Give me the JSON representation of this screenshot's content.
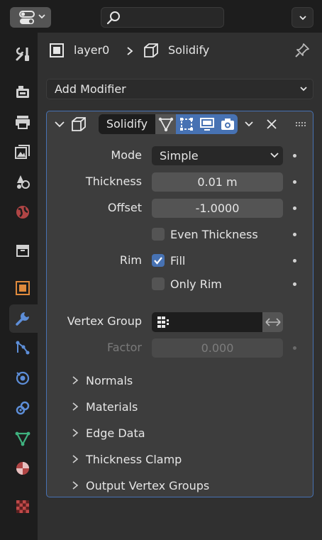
{
  "topbar": {
    "editor_type_icon": "properties-editor-icon",
    "search_icon": "search-icon",
    "search_placeholder": ""
  },
  "sidebar": {
    "tabs": [
      {
        "name": "tool",
        "icon": "wrench-screwdriver-icon",
        "active": false
      },
      {
        "name": "render",
        "icon": "camera-back-icon",
        "active": false
      },
      {
        "name": "output",
        "icon": "printer-icon",
        "active": false
      },
      {
        "name": "view-layer",
        "icon": "images-icon",
        "active": false
      },
      {
        "name": "scene",
        "icon": "scene-icon",
        "active": false
      },
      {
        "name": "world",
        "icon": "globe-icon",
        "active": false
      },
      {
        "name": "collection",
        "icon": "collection-box-icon",
        "active": false
      },
      {
        "name": "object",
        "icon": "object-square-icon",
        "active": false
      },
      {
        "name": "modifiers",
        "icon": "wrench-icon",
        "active": true
      },
      {
        "name": "particles",
        "icon": "particles-icon",
        "active": false
      },
      {
        "name": "physics",
        "icon": "physics-icon",
        "active": false
      },
      {
        "name": "constraints",
        "icon": "constraints-icon",
        "active": false
      },
      {
        "name": "data",
        "icon": "mesh-data-icon",
        "active": false
      },
      {
        "name": "material",
        "icon": "material-sphere-icon",
        "active": false
      },
      {
        "name": "texture",
        "icon": "checkerboard-icon",
        "active": false
      }
    ]
  },
  "header": {
    "object_name": "layer0",
    "modifier_name": "Solidify",
    "pin_icon": "pin-icon"
  },
  "add_modifier": {
    "label": "Add Modifier"
  },
  "modifier": {
    "name": "Solidify",
    "mode_label": "Mode",
    "mode_value": "Simple",
    "thickness_label": "Thickness",
    "thickness_value": "0.01 m",
    "offset_label": "Offset",
    "offset_value": "-1.0000",
    "even_thickness_label": "Even Thickness",
    "even_thickness_checked": false,
    "rim_label": "Rim",
    "fill_label": "Fill",
    "fill_checked": true,
    "only_rim_label": "Only Rim",
    "only_rim_checked": false,
    "vertex_group_label": "Vertex Group",
    "vertex_group_value": "",
    "factor_label": "Factor",
    "factor_value": "0.000",
    "subpanels": [
      "Normals",
      "Materials",
      "Edge Data",
      "Thickness Clamp",
      "Output Vertex Groups"
    ]
  },
  "colors": {
    "accent": "#4772b3",
    "background": "#303030",
    "panel": "#3d3d3d",
    "sidebar": "#1d1d1d"
  }
}
